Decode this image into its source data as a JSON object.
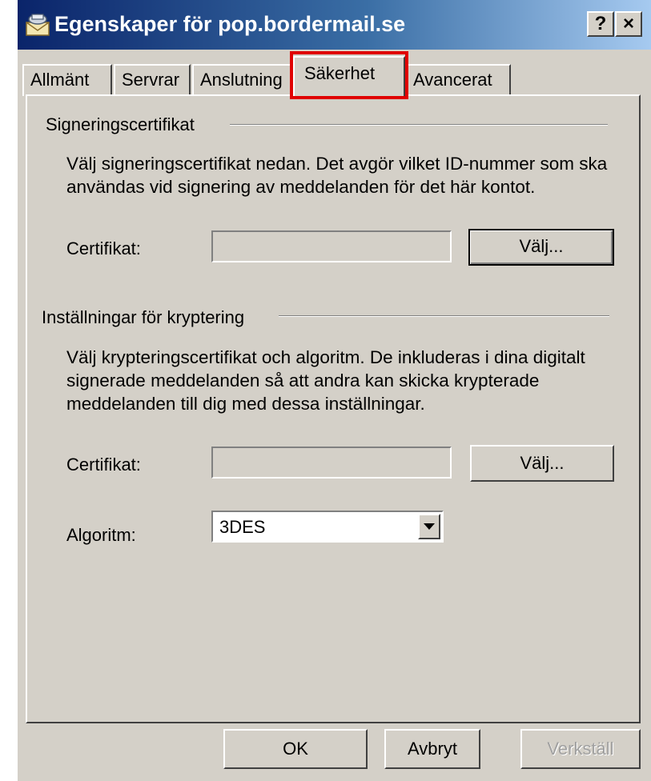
{
  "window": {
    "title": "Egenskaper för pop.bordermail.se",
    "help_label": "?",
    "close_label": "×"
  },
  "tabs": [
    {
      "label": "Allmänt"
    },
    {
      "label": "Servrar"
    },
    {
      "label": "Anslutning"
    },
    {
      "label": "Säkerhet",
      "active": true
    },
    {
      "label": "Avancerat"
    }
  ],
  "signing": {
    "group_label": "Signeringscertifikat",
    "description": "Välj signeringscertifikat nedan. Det avgör vilket ID-nummer som ska användas vid signering av meddelanden för det här kontot.",
    "cert_label": "Certifikat:",
    "cert_value": "",
    "choose_label": "Välj..."
  },
  "encryption": {
    "group_label": "Inställningar för kryptering",
    "description": "Välj krypteringscertifikat och algoritm. De inkluderas i dina digitalt signerade meddelanden så att andra kan skicka krypterade meddelanden till dig med dessa inställningar.",
    "cert_label": "Certifikat:",
    "cert_value": "",
    "choose_label": "Välj...",
    "algorithm_label": "Algoritm:",
    "algorithm_value": "3DES"
  },
  "footer": {
    "ok_label": "OK",
    "cancel_label": "Avbryt",
    "apply_label": "Verkställ"
  },
  "colors": {
    "dialog_face": "#d4d0c8",
    "titlebar_start": "#0a246a",
    "titlebar_end": "#a6caf0",
    "highlight_box": "#e00000"
  },
  "icons": {
    "app": "mail-account-icon",
    "dropdown": "chevron-down-icon"
  }
}
